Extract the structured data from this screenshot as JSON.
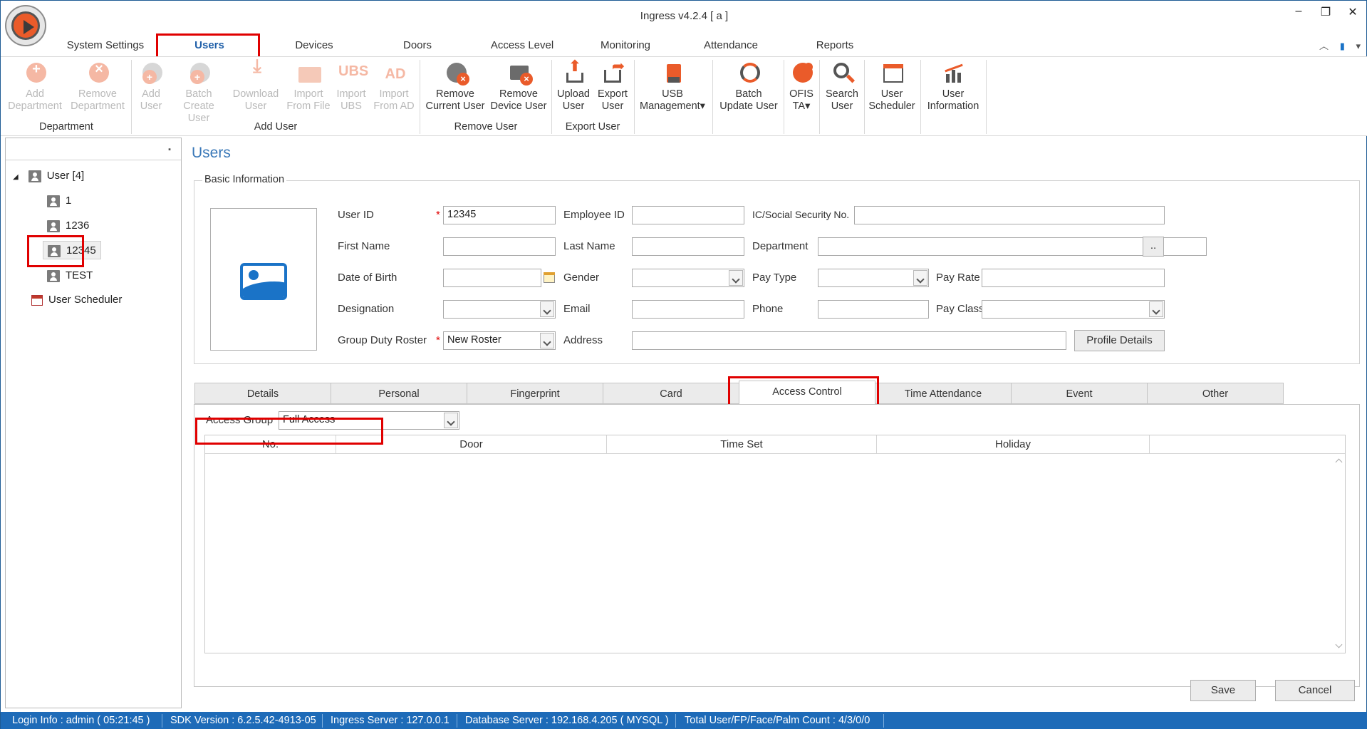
{
  "window": {
    "title": "Ingress v4.2.4 [ a ]",
    "controls": {
      "minimize": "✕",
      "restore": "⧉",
      "close": "✕"
    }
  },
  "ribbon_tabs": [
    {
      "label": "System Settings"
    },
    {
      "label": "Users"
    },
    {
      "label": "Devices"
    },
    {
      "label": "Doors"
    },
    {
      "label": "Access Level"
    },
    {
      "label": "Monitoring"
    },
    {
      "label": "Attendance"
    },
    {
      "label": "Reports"
    }
  ],
  "ribbon": {
    "buttons": [
      {
        "line1": "Add",
        "line2": "Department"
      },
      {
        "line1": "Remove",
        "line2": "Department"
      },
      {
        "line1": "Add",
        "line2": "User"
      },
      {
        "line1": "Batch",
        "line2": "Create User"
      },
      {
        "line1": "Download",
        "line2": "User"
      },
      {
        "line1": "Import",
        "line2": "From File"
      },
      {
        "line1": "Import",
        "line2": "UBS"
      },
      {
        "line1": "Import",
        "line2": "From AD"
      },
      {
        "line1": "Remove",
        "line2": "Current User"
      },
      {
        "line1": "Remove",
        "line2": "Device User"
      },
      {
        "line1": "Upload",
        "line2": "User"
      },
      {
        "line1": "Export",
        "line2": "User"
      },
      {
        "line1": "USB",
        "line2": "Management"
      },
      {
        "line1": "Batch",
        "line2": "Update User"
      },
      {
        "line1": "OFIS",
        "line2": "TA"
      },
      {
        "line1": "Search",
        "line2": "User"
      },
      {
        "line1": "User",
        "line2": "Scheduler"
      },
      {
        "line1": "User",
        "line2": "Information"
      }
    ],
    "groups": [
      {
        "label": "Department"
      },
      {
        "label": "Add User"
      },
      {
        "label": "Remove User"
      },
      {
        "label": "Export User"
      }
    ],
    "icon_text": {
      "ubs": "UBS",
      "ad": "AD"
    }
  },
  "tree": {
    "root": "User [4]",
    "users": [
      "1",
      "1236",
      "12345",
      "TEST"
    ],
    "scheduler": "User Scheduler"
  },
  "page": {
    "title": "Users",
    "basic_info_legend": "Basic Information"
  },
  "form": {
    "labels": {
      "user_id": "User ID",
      "employee_id": "Employee ID",
      "ic_no": "IC/Social Security No.",
      "first_name": "First Name",
      "last_name": "Last Name",
      "department": "Department",
      "dob": "Date of Birth",
      "gender": "Gender",
      "pay_type": "Pay Type",
      "pay_rate": "Pay Rate",
      "designation": "Designation",
      "email": "Email",
      "phone": "Phone",
      "pay_class": "Pay Class",
      "group_duty_roster": "Group Duty Roster",
      "address": "Address"
    },
    "values": {
      "user_id": "12345",
      "employee_id": "",
      "ic_no": "",
      "first_name": "",
      "last_name": "",
      "department": "",
      "dob": "",
      "gender": "",
      "pay_type": "",
      "pay_rate": "",
      "designation": "",
      "email": "",
      "phone": "",
      "pay_class": "",
      "group_duty_roster": "New Roster",
      "address": ""
    },
    "required_mark": "*",
    "department_browse": "..",
    "profile_details": "Profile Details"
  },
  "subtabs": [
    {
      "label": "Details"
    },
    {
      "label": "Personal"
    },
    {
      "label": "Fingerprint"
    },
    {
      "label": "Card"
    },
    {
      "label": "Access Control"
    },
    {
      "label": "Time Attendance"
    },
    {
      "label": "Event"
    },
    {
      "label": "Other"
    }
  ],
  "access_control": {
    "group_label": "Access Group",
    "group_value": "Full Access",
    "columns": [
      "No.",
      "Door",
      "Time Set",
      "Holiday"
    ],
    "rows": []
  },
  "actions": {
    "save": "Save",
    "cancel": "Cancel"
  },
  "status": {
    "login": "Login Info : admin ( 05:21:45 )",
    "sdk": "SDK Version : 6.2.5.42-4913-05",
    "server": "Ingress Server : 127.0.0.1",
    "db": "Database Server : 192.168.4.205 ( MYSQL )",
    "count": "Total User/FP/Face/Palm Count : 4/3/0/0"
  },
  "colors": {
    "accent": "#1e6bb8",
    "highlight": "#e00000",
    "icon_orange": "#ea5b2a",
    "title_blue": "#3a78b8"
  }
}
